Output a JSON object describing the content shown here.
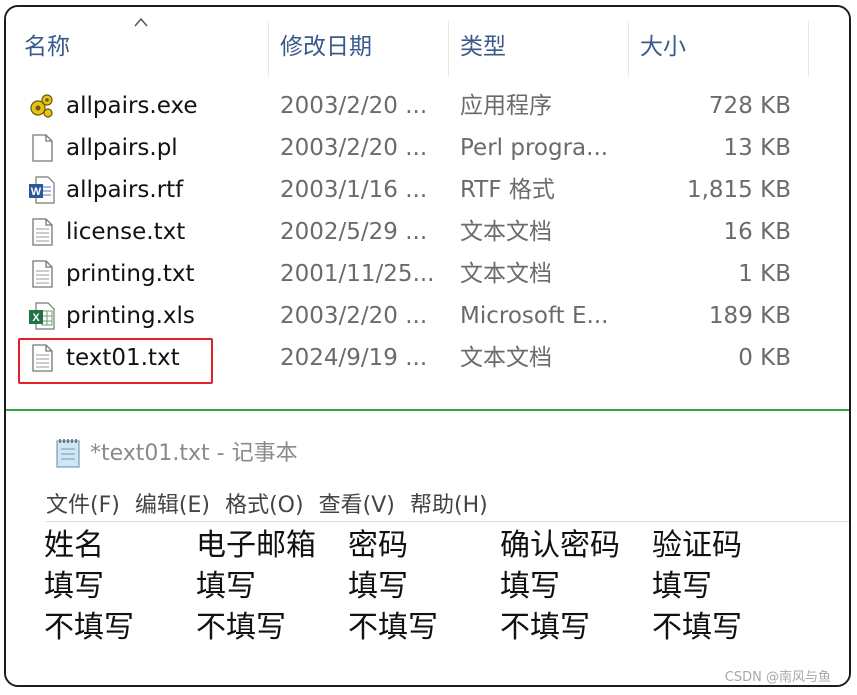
{
  "explorer": {
    "columns": {
      "name": "名称",
      "date": "修改日期",
      "type": "类型",
      "size": "大小"
    },
    "files": [
      {
        "name": "allpairs.exe",
        "date": "2003/2/20 ...",
        "type": "应用程序",
        "size": "728 KB",
        "icon": "exe-icon"
      },
      {
        "name": "allpairs.pl",
        "date": "2003/2/20 ...",
        "type": "Perl progra...",
        "size": "13 KB",
        "icon": "file-icon"
      },
      {
        "name": "allpairs.rtf",
        "date": "2003/1/16 ...",
        "type": "RTF 格式",
        "size": "1,815 KB",
        "icon": "word-icon"
      },
      {
        "name": "license.txt",
        "date": "2002/5/29 ...",
        "type": "文本文档",
        "size": "16 KB",
        "icon": "text-file-icon"
      },
      {
        "name": "printing.txt",
        "date": "2001/11/25...",
        "type": "文本文档",
        "size": "1 KB",
        "icon": "text-file-icon"
      },
      {
        "name": "printing.xls",
        "date": "2003/2/20 ...",
        "type": "Microsoft E...",
        "size": "189 KB",
        "icon": "excel-icon"
      },
      {
        "name": "text01.txt",
        "date": "2024/9/19 ...",
        "type": "文本文档",
        "size": "0 KB",
        "icon": "text-file-icon"
      }
    ]
  },
  "notepad": {
    "title": "*text01.txt - 记事本",
    "menu": [
      "文件(F)",
      "编辑(E)",
      "格式(O)",
      "查看(V)",
      "帮助(H)"
    ],
    "lines": [
      [
        "姓名",
        "电子邮箱",
        "密码",
        "确认密码",
        "验证码"
      ],
      [
        "填写",
        "填写",
        "填写",
        "填写",
        "填写"
      ],
      [
        "不填写",
        "不填写",
        "不填写",
        "不填写",
        "不填写"
      ]
    ]
  },
  "watermark": "CSDN @南风与鱼",
  "colors": {
    "highlight": "#e0202a",
    "divider": "#2aa84a",
    "header_text": "#3a5a8c"
  }
}
